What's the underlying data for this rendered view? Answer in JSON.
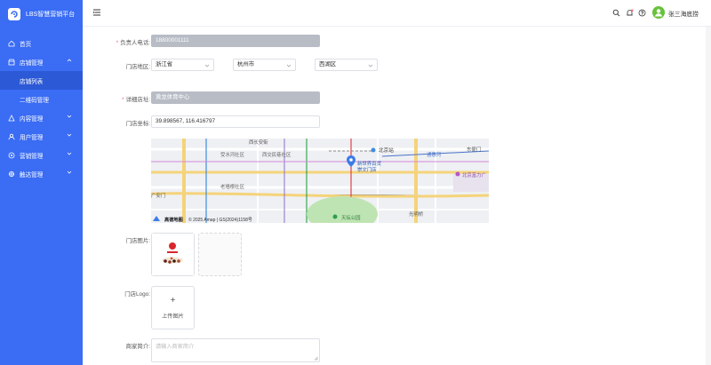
{
  "app": {
    "title": "LBS智慧营销平台"
  },
  "sidebar": {
    "items": [
      {
        "label": "首页",
        "icon": "home-icon"
      },
      {
        "label": "店铺管理",
        "icon": "shop-icon",
        "expanded": true
      },
      {
        "label": "店铺列表",
        "active": true
      },
      {
        "label": "二维码管理"
      },
      {
        "label": "内容管理",
        "icon": "content-icon"
      },
      {
        "label": "用户管理",
        "icon": "user-icon"
      },
      {
        "label": "营销管理",
        "icon": "marketing-icon"
      },
      {
        "label": "触达管理",
        "icon": "reach-icon"
      }
    ]
  },
  "header": {
    "user_name": "张三海底捞"
  },
  "form": {
    "phone_label": "负责人电话:",
    "phone_value": "18800001111",
    "region_label": "门店地区:",
    "province": "浙江省",
    "city": "杭州市",
    "district": "西湖区",
    "address_label": "详细店址:",
    "address_value": "黄龙体育中心",
    "coords_label": "门店坐标:",
    "coords_value": "39.898567, 116.416797",
    "photos_label": "门店图片:",
    "logo_label": "门店Logo:",
    "upload_label": "上传图片",
    "intro_label": "商家简介:",
    "intro_placeholder": "请输入商家简介"
  },
  "map": {
    "labels": {
      "xichang": "西长安街",
      "xisongs": "受水河社区",
      "xichengtiao": "西交民巷社区",
      "laoqiang": "老墙根社区",
      "beijingzhan": "北京站",
      "tonghuihe": "通惠河",
      "dongbianmen": "东便门",
      "store_line1": "新世界百货",
      "store_line2": "崇文门店",
      "fuli": "北京富力广",
      "tiantan": "天坛公园",
      "guangming": "光明桥",
      "xi2": "西二环",
      "dong2": "东二环",
      "tianqiao": "天桥",
      "dong3": "东三环",
      "guangan": "广安门",
      "rights": "© 2025 Amap | GS(2024)1158号",
      "brand": "高德地图"
    }
  },
  "colors": {
    "sidebar": "#3a6cf4",
    "sidebar_active": "#2c59d6",
    "accent": "#409eff",
    "required": "#f56c6c",
    "avatar": "#67c23a"
  }
}
